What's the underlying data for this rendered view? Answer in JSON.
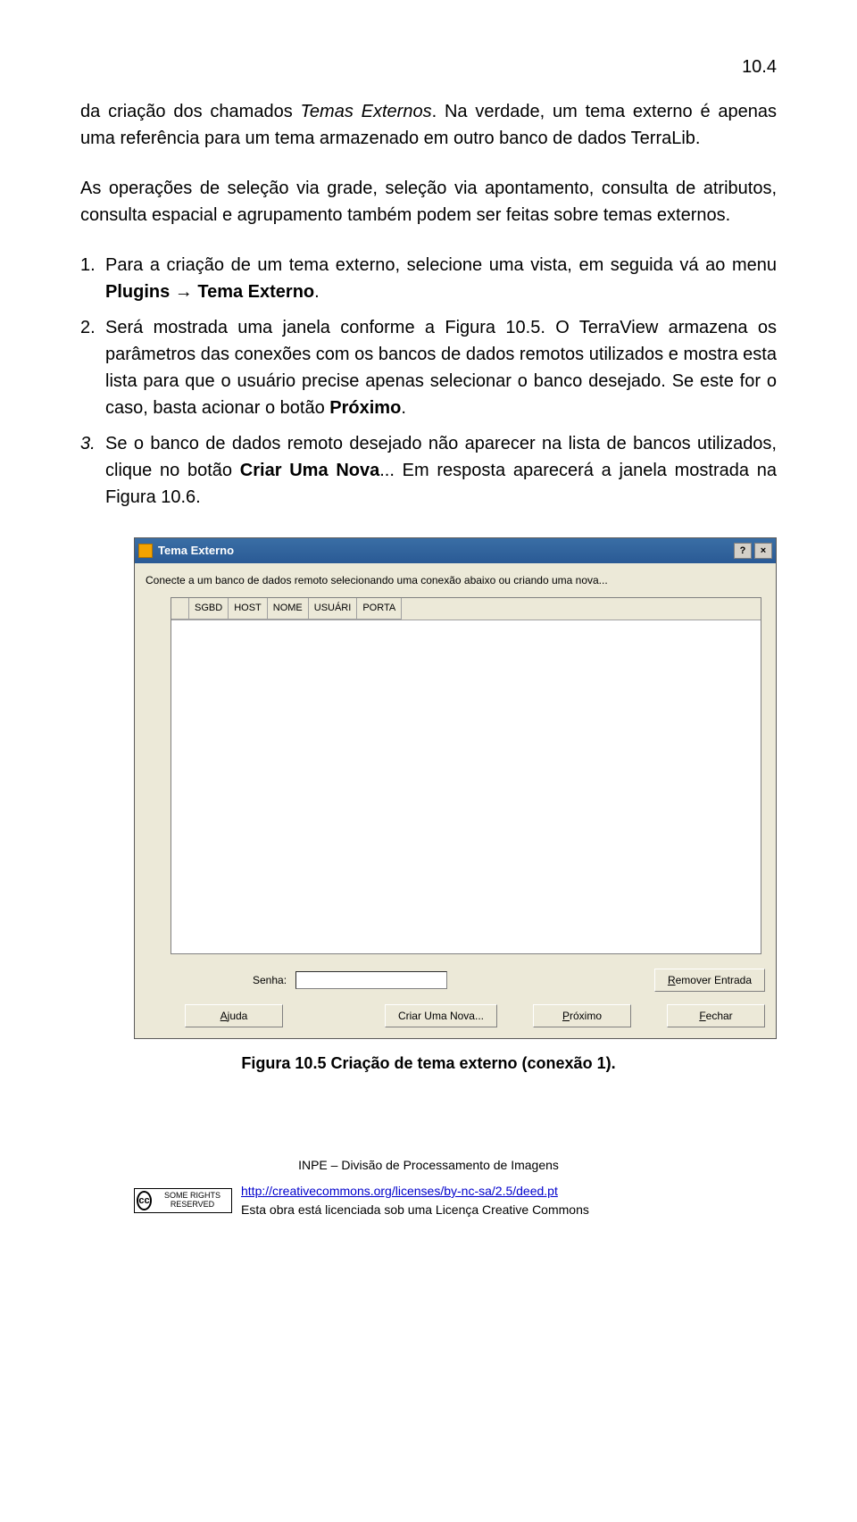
{
  "page_number": "10.4",
  "paragraphs": {
    "p1_a": "da criação dos chamados ",
    "p1_italic": "Temas Externos",
    "p1_b": ". Na verdade, um tema externo é apenas uma referência para um tema armazenado em outro banco de dados TerraLib.",
    "p2": "As operações de seleção via grade, seleção via apontamento, consulta de atributos, consulta espacial e agrupamento também podem ser feitas sobre temas externos."
  },
  "list": {
    "n1": "1.",
    "i1_a": "Para a criação de um tema externo, selecione uma vista, em seguida vá ao menu ",
    "i1_b1": "Plugins",
    "i1_arrow": " → ",
    "i1_b2": "Tema Externo",
    "i1_c": ".",
    "n2": "2.",
    "i2_a": "Será mostrada uma janela conforme a Figura 10.5. O TerraView armazena os parâmetros das conexões com os bancos de dados remotos utilizados e mostra esta lista para que o usuário precise apenas selecionar o banco desejado. Se este for o caso, basta acionar o botão ",
    "i2_b": "Próximo",
    "i2_c": ".",
    "n3": "3.",
    "i3_a": "Se o banco de dados remoto desejado não aparecer na lista de bancos utilizados, clique no botão ",
    "i3_b": "Criar Uma Nova",
    "i3_c": "... Em resposta aparecerá a janela mostrada na Figura 10.6."
  },
  "dialog": {
    "title": "Tema Externo",
    "help_btn": "?",
    "close_btn": "×",
    "instruction": "Conecte a um banco de dados remoto selecionando uma conexão abaixo ou criando uma nova...",
    "headers": [
      "SGBD",
      "HOST",
      "NOME",
      "USUÁRI",
      "PORTA"
    ],
    "senha_label": "Senha:",
    "remover": "Remover Entrada",
    "ajuda": "Ajuda",
    "criar": "Criar Uma Nova...",
    "proximo": "Próximo",
    "fechar": "Fechar"
  },
  "caption": "Figura 10.5  Criação de tema externo (conexão 1).",
  "footer": {
    "line1": "INPE – Divisão de Processamento de Imagens",
    "cc_badge": "SOME RIGHTS RESERVED",
    "cc_cc": "cc",
    "cc_link": "http://creativecommons.org/licenses/by-nc-sa/2.5/deed.pt",
    "cc_desc": "Esta obra está licenciada sob uma Licença Creative Commons"
  }
}
